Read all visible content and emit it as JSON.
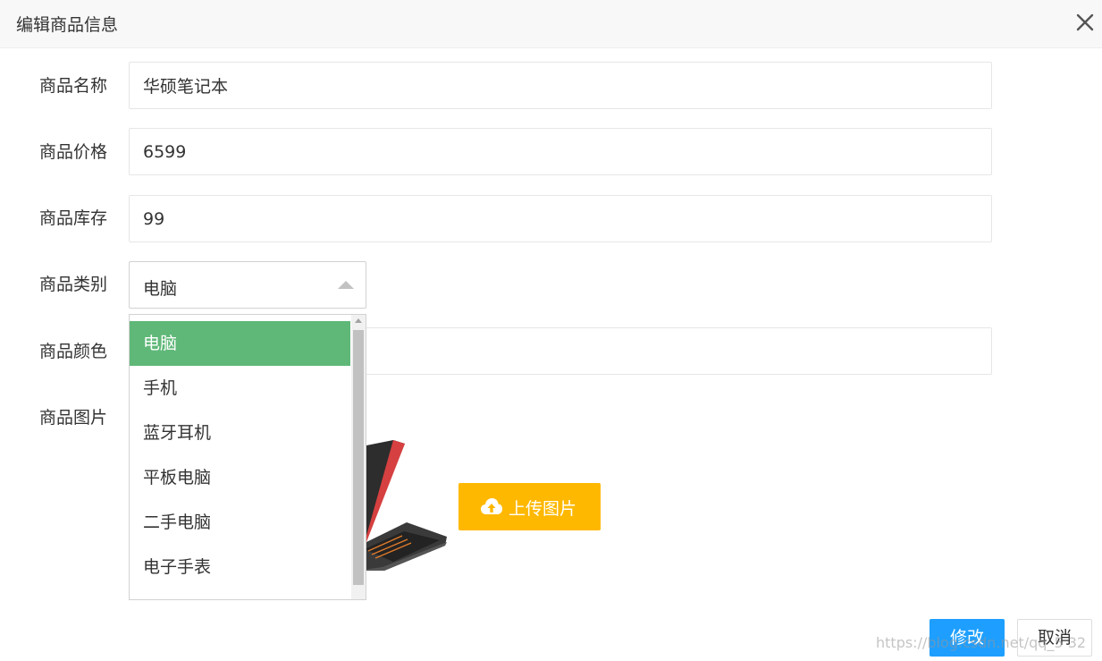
{
  "dialog": {
    "title": "编辑商品信息"
  },
  "form": {
    "name_label": "商品名称",
    "name_value": "华硕笔记本",
    "price_label": "商品价格",
    "price_value": "6599",
    "stock_label": "商品库存",
    "stock_value": "99",
    "category_label": "商品类别",
    "category_value": "电脑",
    "color_label": "商品颜色",
    "color_value": "",
    "image_label": "商品图片"
  },
  "dropdown": {
    "options": [
      "电脑",
      "手机",
      "蓝牙耳机",
      "平板电脑",
      "二手电脑",
      "电子手表"
    ],
    "selected_index": 0
  },
  "upload": {
    "label": "上传图片",
    "icon": "cloud-upload-icon"
  },
  "footer": {
    "submit_label": "修改",
    "cancel_label": "取消"
  },
  "watermark": {
    "text": "https://blog.csdn.net/qq_5     32"
  },
  "colors": {
    "selected_option": "#5fb878",
    "upload_button": "#ffb800",
    "primary_button": "#1e9fff"
  }
}
